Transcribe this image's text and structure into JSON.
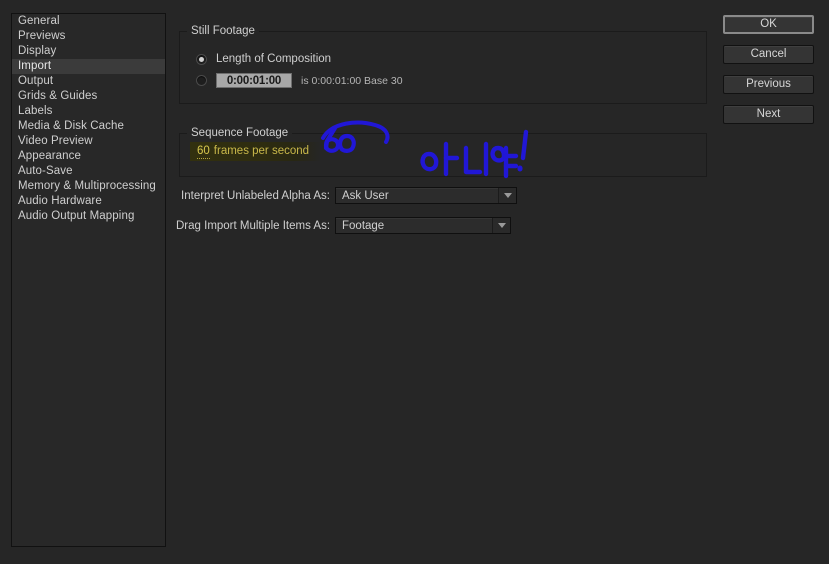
{
  "sidebar": {
    "items": [
      {
        "label": "General",
        "selected": false
      },
      {
        "label": "Previews",
        "selected": false
      },
      {
        "label": "Display",
        "selected": false
      },
      {
        "label": "Import",
        "selected": true
      },
      {
        "label": "Output",
        "selected": false
      },
      {
        "label": "Grids & Guides",
        "selected": false
      },
      {
        "label": "Labels",
        "selected": false
      },
      {
        "label": "Media & Disk Cache",
        "selected": false
      },
      {
        "label": "Video Preview",
        "selected": false
      },
      {
        "label": "Appearance",
        "selected": false
      },
      {
        "label": "Auto-Save",
        "selected": false
      },
      {
        "label": "Memory & Multiprocessing",
        "selected": false
      },
      {
        "label": "Audio Hardware",
        "selected": false
      },
      {
        "label": "Audio Output Mapping",
        "selected": false
      }
    ]
  },
  "still_footage": {
    "group_title": "Still Footage",
    "option_length_of_composition": "Length of Composition",
    "option_length_selected": true,
    "duration_value": "0:00:01:00",
    "duration_selected": false,
    "duration_note": "is 0:00:01:00  Base 30"
  },
  "sequence_footage": {
    "group_title": "Sequence Footage",
    "fps_value": "60",
    "fps_suffix": "frames per second"
  },
  "fields": {
    "interpret_alpha_label": "Interpret Unlabeled Alpha As:",
    "interpret_alpha_value": "Ask User",
    "drag_import_label": "Drag Import Multiple Items As:",
    "drag_import_value": "Footage"
  },
  "buttons": {
    "ok": "OK",
    "cancel": "Cancel",
    "previous": "Previous",
    "next": "Next"
  },
  "annotation": {
    "circled_number": "60",
    "handwritten_text": "아니야!",
    "ink_color": "#2117d6"
  },
  "colors": {
    "background": "#262626",
    "panel": "#282828",
    "selection": "#3b3b3b",
    "text": "#cfcfcf",
    "hot_text": "#d8c84e",
    "field_light": "#a8a8a8"
  }
}
